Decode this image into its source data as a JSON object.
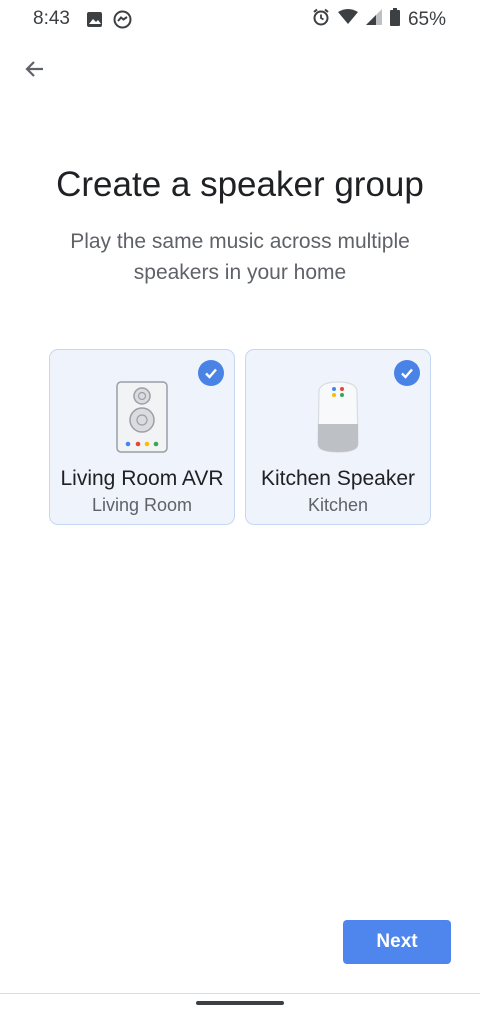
{
  "status_bar": {
    "time": "8:43",
    "battery": "65%",
    "icons": [
      "image-icon",
      "messenger-icon",
      "alarm-icon",
      "wifi-icon",
      "signal-icon",
      "battery-icon"
    ]
  },
  "header": {
    "back_icon": "arrow-back-icon"
  },
  "main": {
    "title": "Create a speaker group",
    "subtitle": "Play the same music across multiple speakers in your home",
    "devices": [
      {
        "name": "Living Room AVR",
        "room": "Living Room",
        "selected": true,
        "icon": "speaker-tower-icon"
      },
      {
        "name": "Kitchen Speaker",
        "room": "Kitchen",
        "selected": true,
        "icon": "google-home-icon"
      }
    ]
  },
  "footer": {
    "next_label": "Next"
  },
  "colors": {
    "accent": "#4f86ed",
    "card_bg": "#eef3fc",
    "card_border": "#c6d7f2"
  }
}
